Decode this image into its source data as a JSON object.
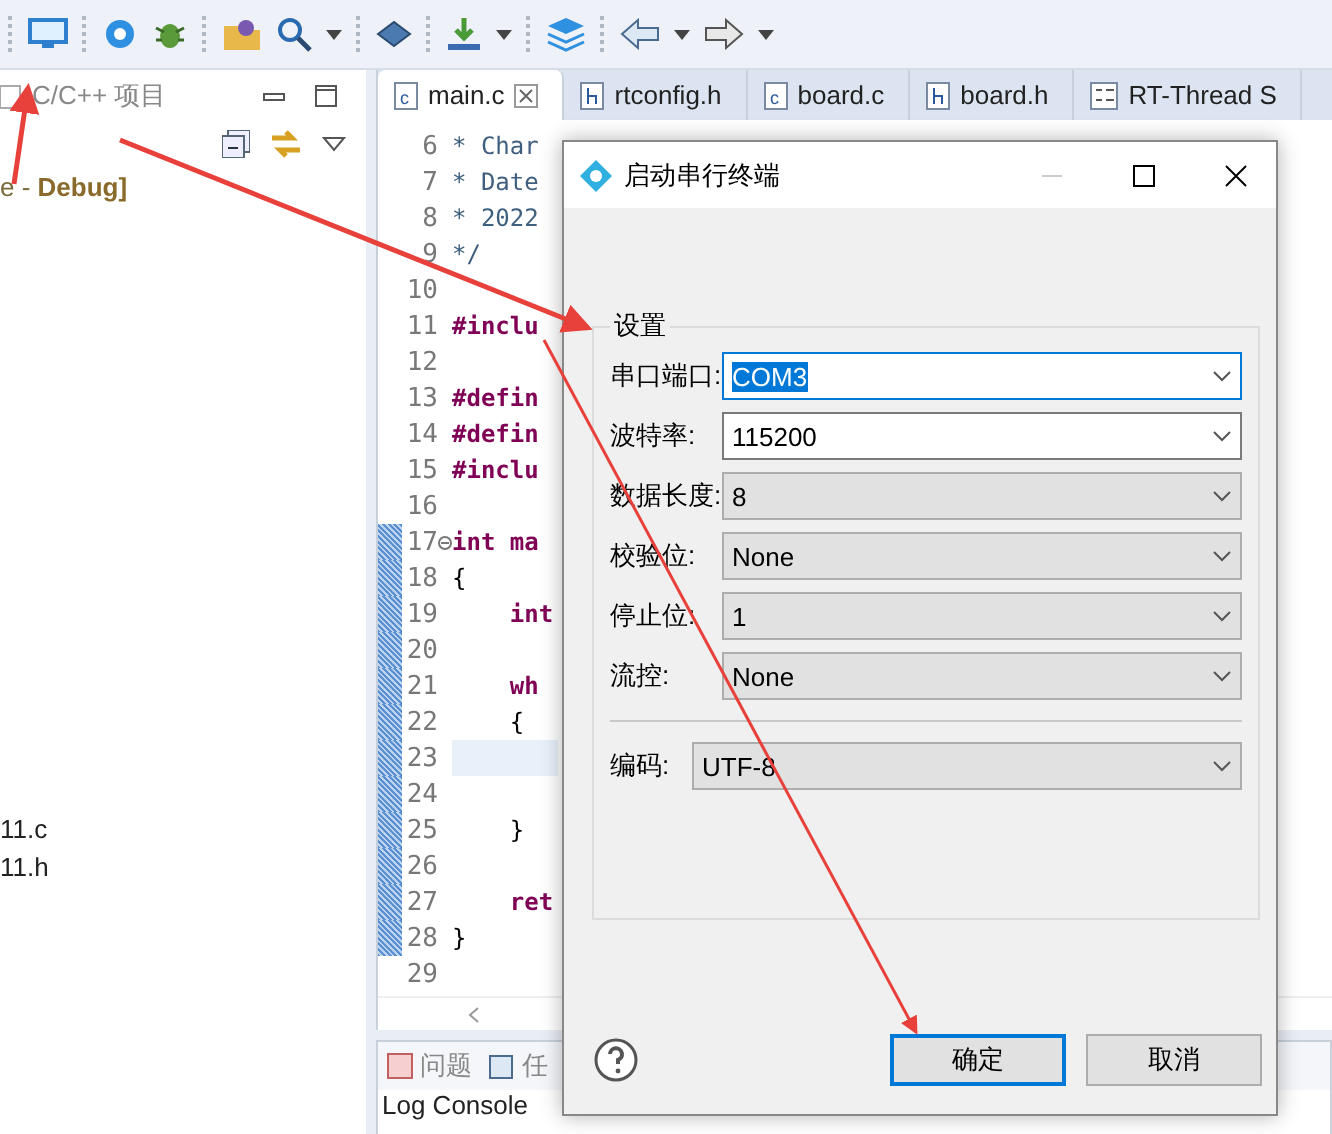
{
  "project_panel": {
    "title": "C/C++ 项目",
    "project_label": "e - **Debug]**",
    "files": [
      "11.c",
      "11.h"
    ]
  },
  "editor": {
    "tabs": [
      {
        "label": "main.c",
        "kind": "c",
        "selected": true
      },
      {
        "label": "rtconfig.h",
        "kind": "h",
        "selected": false
      },
      {
        "label": "board.c",
        "kind": "c",
        "selected": false
      },
      {
        "label": "board.h",
        "kind": "h",
        "selected": false
      },
      {
        "label": "RT-Thread S",
        "kind": "settings",
        "selected": false
      }
    ],
    "lines": [
      {
        "number": "6",
        "text": "* Char",
        "kind": "comment",
        "marked": false,
        "current": false,
        "foldable": false
      },
      {
        "number": "7",
        "text": "* Date",
        "kind": "comment",
        "marked": false,
        "current": false,
        "foldable": false
      },
      {
        "number": "8",
        "text": "* 2022",
        "kind": "comment",
        "marked": false,
        "current": false,
        "foldable": false
      },
      {
        "number": "9",
        "text": "*/",
        "kind": "comment",
        "marked": false,
        "current": false,
        "foldable": false
      },
      {
        "number": "10",
        "kind": "plain",
        "marked": false,
        "current": false,
        "foldable": false
      },
      {
        "number": "11",
        "text": "#inclu",
        "kind": "directive",
        "marked": false,
        "current": false,
        "foldable": false
      },
      {
        "number": "12",
        "kind": "plain",
        "marked": false,
        "current": false,
        "foldable": false
      },
      {
        "number": "13",
        "text": "#defin",
        "kind": "directive",
        "marked": false,
        "current": false,
        "foldable": false
      },
      {
        "number": "14",
        "text": "#defin",
        "kind": "directive",
        "marked": false,
        "current": false,
        "foldable": false
      },
      {
        "number": "15",
        "text": "#inclu",
        "kind": "directive",
        "marked": false,
        "current": false,
        "foldable": false
      },
      {
        "number": "16",
        "kind": "plain",
        "marked": false,
        "current": false,
        "foldable": false
      },
      {
        "number": "17",
        "text": "int ma",
        "kind": "keyword",
        "marked": true,
        "current": false,
        "foldable": true
      },
      {
        "number": "18",
        "text": "{",
        "kind": "plain",
        "marked": true,
        "current": false,
        "foldable": false
      },
      {
        "number": "19",
        "text": "    int",
        "kind": "keyword",
        "marked": true,
        "current": false,
        "foldable": false
      },
      {
        "number": "20",
        "kind": "plain",
        "marked": true,
        "current": false,
        "foldable": false
      },
      {
        "number": "21",
        "text": "    wh",
        "kind": "keyword",
        "marked": true,
        "current": false,
        "foldable": false
      },
      {
        "number": "22",
        "text": "    {",
        "kind": "plain",
        "marked": true,
        "current": false,
        "foldable": false
      },
      {
        "number": "23",
        "kind": "plain",
        "marked": true,
        "current": true,
        "foldable": false
      },
      {
        "number": "24",
        "kind": "plain",
        "marked": true,
        "current": false,
        "foldable": false
      },
      {
        "number": "25",
        "text": "    }",
        "kind": "plain",
        "marked": true,
        "current": false,
        "foldable": false
      },
      {
        "number": "26",
        "kind": "plain",
        "marked": true,
        "current": false,
        "foldable": false
      },
      {
        "number": "27",
        "text": "    ret",
        "kind": "keyword",
        "marked": true,
        "current": false,
        "foldable": false
      },
      {
        "number": "28",
        "text": "}",
        "kind": "plain",
        "marked": true,
        "current": false,
        "foldable": false
      },
      {
        "number": "29",
        "kind": "plain",
        "marked": false,
        "current": false,
        "foldable": false
      }
    ]
  },
  "bottom_panel": {
    "tabs": [
      {
        "label": "问题",
        "kind": "problems"
      },
      {
        "label": "任",
        "kind": "tasks"
      }
    ],
    "console_title": "Log Console"
  },
  "dialog": {
    "title": "启动串行终端",
    "group": "设置",
    "fields": [
      {
        "label": "串口端口:",
        "value": "COM3",
        "kind": "editable",
        "focused": true
      },
      {
        "label": "波特率:",
        "value": "115200",
        "kind": "editable",
        "focused": false
      },
      {
        "label": "数据长度:",
        "value": "8",
        "kind": "readonly",
        "focused": false
      },
      {
        "label": "校验位:",
        "value": "None",
        "kind": "readonly",
        "focused": false
      },
      {
        "label": "停止位:",
        "value": "1",
        "kind": "readonly",
        "focused": false
      },
      {
        "label": "流控:",
        "value": "None",
        "kind": "readonly",
        "focused": false
      }
    ],
    "encoding": {
      "label": "编码:",
      "value": "UTF-8"
    },
    "buttons": [
      {
        "label": "确定",
        "default": true
      },
      {
        "label": "取消",
        "default": false
      }
    ]
  }
}
